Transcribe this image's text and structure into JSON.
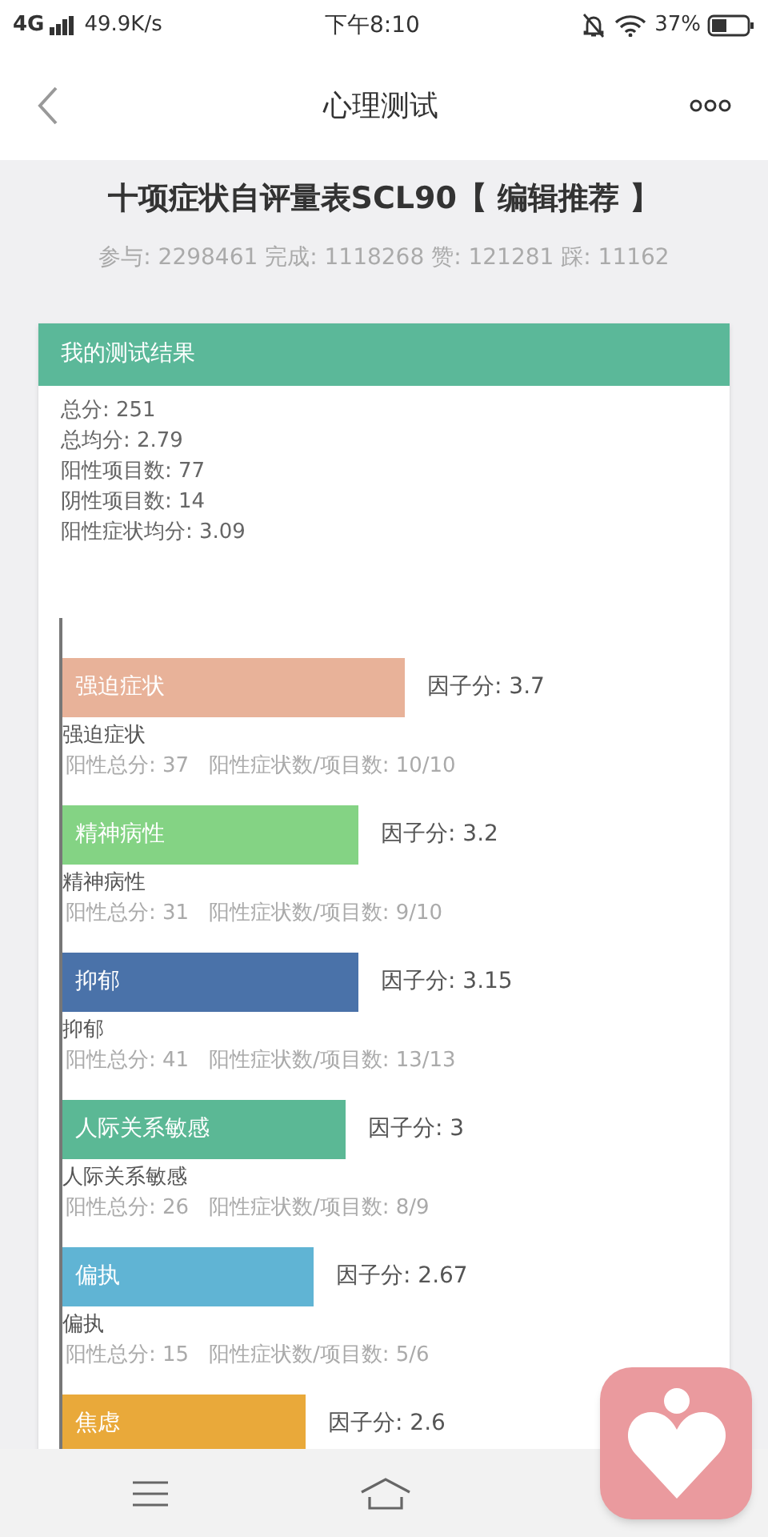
{
  "status_bar": {
    "network": "4G",
    "speed": "49.9K/s",
    "time": "下午8:10",
    "battery": "37%"
  },
  "header": {
    "title": "心理测试"
  },
  "test": {
    "title": "十项症状自评量表SCL90【 编辑推荐 】",
    "stats": "参与: 2298461 完成: 1118268 赞: 121281 踩: 11162"
  },
  "result": {
    "heading": "我的测试结果",
    "summary": [
      "总分: 251",
      "总均分: 2.79",
      "阳性项目数: 77",
      "阴性项目数: 14",
      "阳性症状均分: 3.09"
    ],
    "factors": [
      {
        "bar_label": "强迫症状",
        "score": "因子分: 3.7",
        "color": "#e8b299",
        "name": "强迫症状",
        "detail": "阳性总分: 37   阳性症状数/项目数: 10/10"
      },
      {
        "bar_label": "精神病性",
        "score": "因子分: 3.2",
        "color": "#84d384",
        "name": "精神病性",
        "detail": "阳性总分: 31   阳性症状数/项目数: 9/10"
      },
      {
        "bar_label": "抑郁",
        "score": "因子分: 3.15",
        "color": "#4a72a9",
        "name": "抑郁",
        "detail": "阳性总分: 41   阳性症状数/项目数: 13/13"
      },
      {
        "bar_label": "人际关系敏感",
        "score": "因子分: 3",
        "color": "#5bb895",
        "name": "人际关系敏感",
        "detail": "阳性总分: 26   阳性症状数/项目数: 8/9"
      },
      {
        "bar_label": "偏执",
        "score": "因子分: 2.67",
        "color": "#60b4d4",
        "name": "偏执",
        "detail": "阳性总分: 15   阳性症状数/项目数: 5/6"
      },
      {
        "bar_label": "焦虑",
        "score": "因子分: 2.6",
        "color": "#e9a93a"
      }
    ]
  }
}
